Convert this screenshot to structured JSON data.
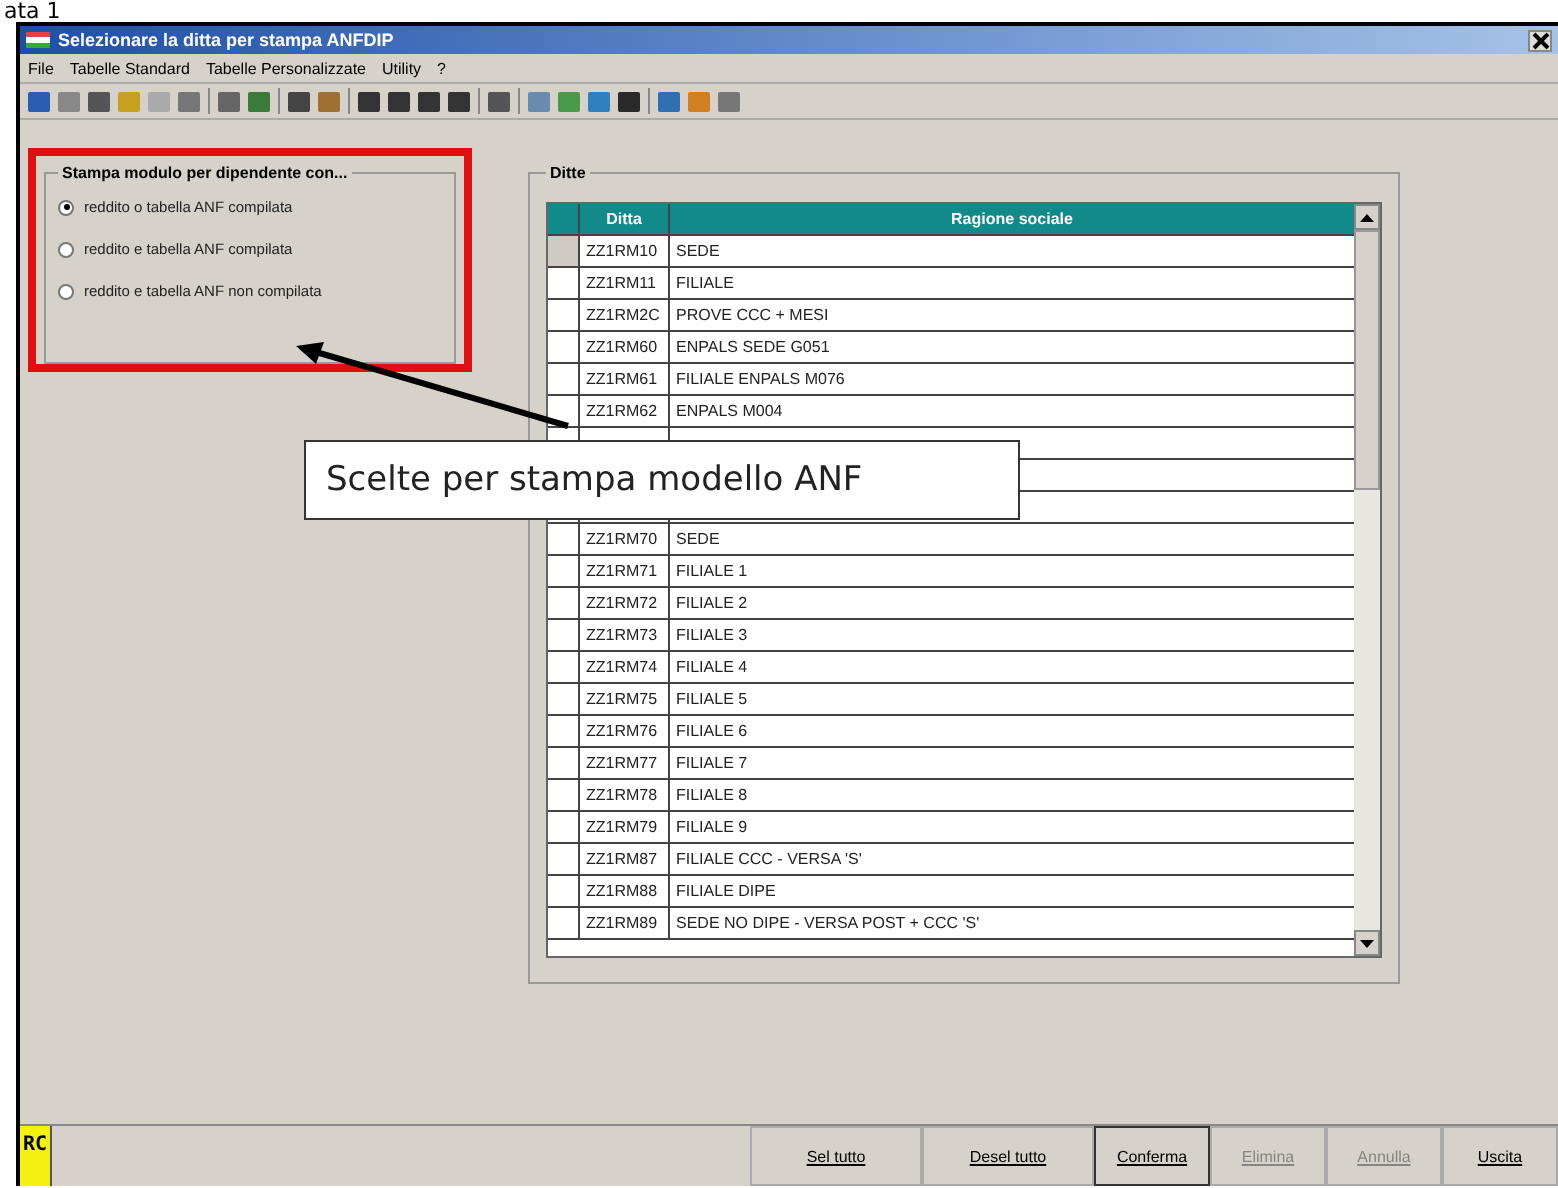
{
  "page_heading": "ata 1",
  "window": {
    "title": "Selezionare la ditta per stampa ANFDIP"
  },
  "menu": [
    "File",
    "Tabelle Standard",
    "Tabelle Personalizzate",
    "Utility",
    "?"
  ],
  "options_group": {
    "title": "Stampa modulo per dipendente con...",
    "options": [
      {
        "label": "reddito o tabella ANF compilata",
        "selected": true
      },
      {
        "label": "reddito e tabella ANF compilata",
        "selected": false
      },
      {
        "label": "reddito e tabella ANF non compilata",
        "selected": false
      }
    ]
  },
  "ditte": {
    "title": "Ditte",
    "columns": [
      "Ditta",
      "Ragione sociale"
    ],
    "rows": [
      {
        "ditta": "ZZ1RM10",
        "ragione": "SEDE",
        "selected": true
      },
      {
        "ditta": "ZZ1RM11",
        "ragione": "FILIALE",
        "selected": false
      },
      {
        "ditta": "ZZ1RM2C",
        "ragione": "PROVE CCC + MESI",
        "selected": false
      },
      {
        "ditta": "ZZ1RM60",
        "ragione": "ENPALS SEDE G051",
        "selected": false
      },
      {
        "ditta": "ZZ1RM61",
        "ragione": "FILIALE ENPALS M076",
        "selected": false
      },
      {
        "ditta": "ZZ1RM62",
        "ragione": "ENPALS M004",
        "selected": false
      },
      {
        "covered": true
      },
      {
        "covered": true
      },
      {
        "covered": true
      },
      {
        "ditta": "ZZ1RM70",
        "ragione": "SEDE",
        "selected": false
      },
      {
        "ditta": "ZZ1RM71",
        "ragione": "FILIALE 1",
        "selected": false
      },
      {
        "ditta": "ZZ1RM72",
        "ragione": "FILIALE 2",
        "selected": false
      },
      {
        "ditta": "ZZ1RM73",
        "ragione": "FILIALE 3",
        "selected": false
      },
      {
        "ditta": "ZZ1RM74",
        "ragione": "FILIALE 4",
        "selected": false
      },
      {
        "ditta": "ZZ1RM75",
        "ragione": "FILIALE 5",
        "selected": false
      },
      {
        "ditta": "ZZ1RM76",
        "ragione": "FILIALE 6",
        "selected": false
      },
      {
        "ditta": "ZZ1RM77",
        "ragione": "FILIALE 7",
        "selected": false
      },
      {
        "ditta": "ZZ1RM78",
        "ragione": "FILIALE 8",
        "selected": false
      },
      {
        "ditta": "ZZ1RM79",
        "ragione": "FILIALE 9",
        "selected": false
      },
      {
        "ditta": "ZZ1RM87",
        "ragione": "FILIALE CCC - VERSA 'S'",
        "selected": false
      },
      {
        "ditta": "ZZ1RM88",
        "ragione": "FILIALE DIPE",
        "selected": false
      },
      {
        "ditta": "ZZ1RM89",
        "ragione": "SEDE NO DIPE - VERSA POST + CCC 'S'",
        "selected": false
      }
    ]
  },
  "callout": {
    "text": "Scelte per stampa modello  ANF"
  },
  "status_badge": "RC",
  "buttons": [
    {
      "label": "Sel tutto",
      "disabled": false
    },
    {
      "label": "Desel tutto",
      "disabled": false
    },
    {
      "label": "Conferma",
      "disabled": false,
      "focused": true
    },
    {
      "label": "Elimina",
      "disabled": true
    },
    {
      "label": "Annulla",
      "disabled": true
    },
    {
      "label": "Uscita",
      "disabled": false
    }
  ]
}
